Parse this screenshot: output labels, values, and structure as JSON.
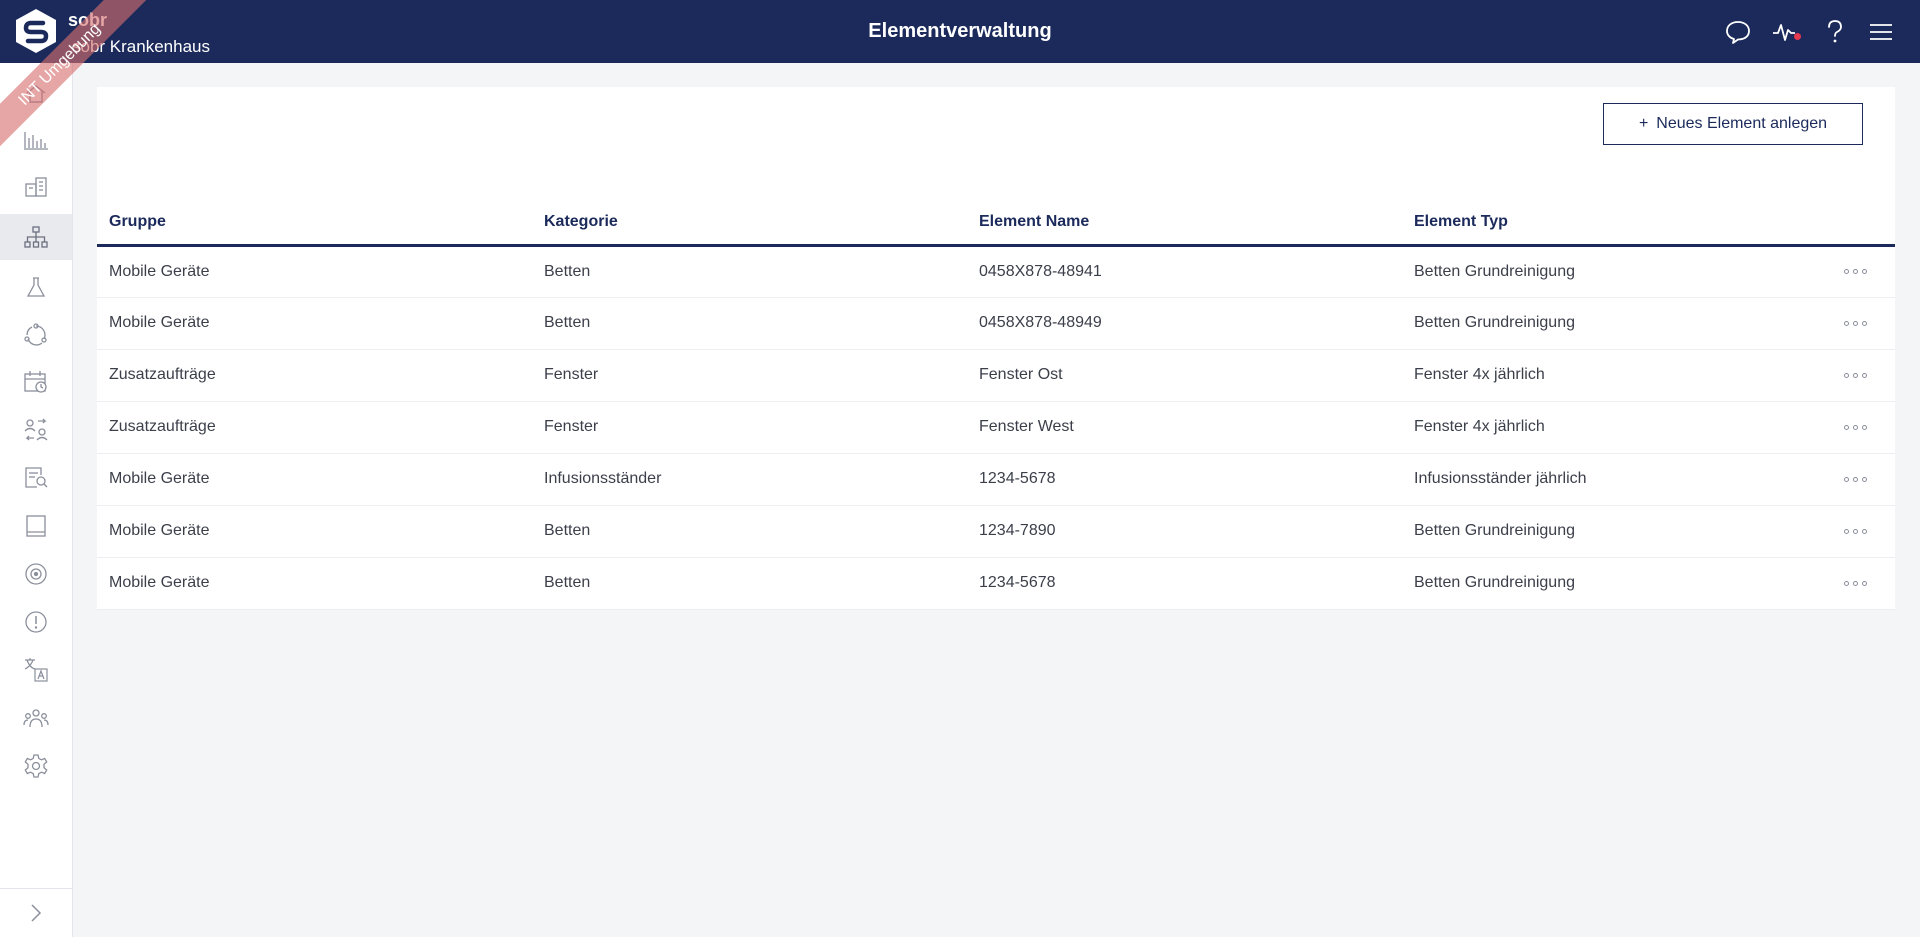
{
  "header": {
    "brand_name": "sobr",
    "brand_sub": "sobr Krankenhaus",
    "title": "Elementverwaltung",
    "ribbon_text": "INT Umgebung",
    "icons": [
      "chat-icon",
      "activity-icon",
      "help-icon",
      "menu-icon"
    ],
    "notification_color": "#e5394f"
  },
  "sidebar": {
    "items": [
      {
        "icon": "home-icon"
      },
      {
        "icon": "analytics-icon"
      },
      {
        "icon": "buildings-icon"
      },
      {
        "icon": "hierarchy-icon",
        "active": true
      },
      {
        "icon": "flask-icon"
      },
      {
        "icon": "cycle-icon"
      },
      {
        "icon": "calendar-clock-icon"
      },
      {
        "icon": "user-swap-icon"
      },
      {
        "icon": "document-search-icon"
      },
      {
        "icon": "book-icon"
      },
      {
        "icon": "target-icon"
      },
      {
        "icon": "alert-icon"
      },
      {
        "icon": "translate-icon"
      },
      {
        "icon": "team-icon"
      },
      {
        "icon": "settings-icon"
      }
    ],
    "expand_icon": "chevron-right-icon"
  },
  "toolbar": {
    "new_element_label": "Neues Element anlegen",
    "new_element_prefix": "+"
  },
  "table": {
    "columns": [
      "Gruppe",
      "Kategorie",
      "Element Name",
      "Element Typ"
    ],
    "rows": [
      [
        "Mobile Geräte",
        "Betten",
        "0458X878-48941",
        "Betten Grundreinigung"
      ],
      [
        "Mobile Geräte",
        "Betten",
        "0458X878-48949",
        "Betten Grundreinigung"
      ],
      [
        "Zusatzaufträge",
        "Fenster",
        "Fenster Ost",
        "Fenster 4x jährlich"
      ],
      [
        "Zusatzaufträge",
        "Fenster",
        "Fenster West",
        "Fenster 4x jährlich"
      ],
      [
        "Mobile Geräte",
        "Infusionsständer",
        "1234-5678",
        "Infusionsständer jährlich"
      ],
      [
        "Mobile Geräte",
        "Betten",
        "1234-7890",
        "Betten Grundreinigung"
      ],
      [
        "Mobile Geräte",
        "Betten",
        "1234-5678",
        "Betten Grundreinigung"
      ]
    ]
  },
  "colors": {
    "header_bg": "#1b2a5b",
    "accent": "#1b2a5b",
    "ribbon": "#d66f6f"
  }
}
